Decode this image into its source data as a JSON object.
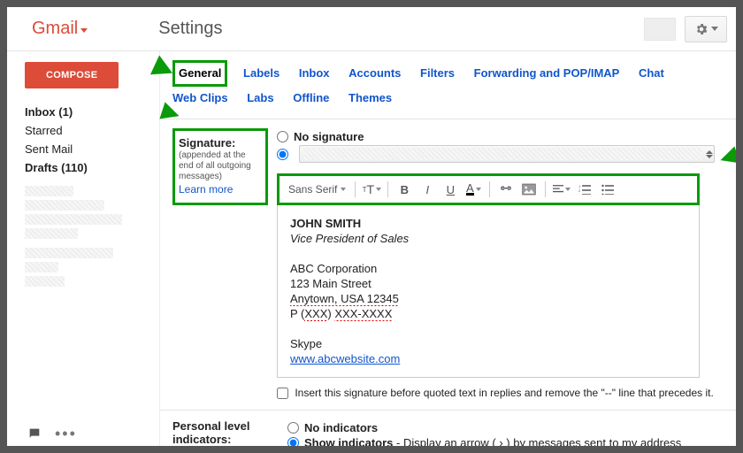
{
  "header": {
    "logo": "Gmail",
    "title": "Settings"
  },
  "sidebar": {
    "compose": "COMPOSE",
    "items": [
      {
        "label": "Inbox (1)",
        "bold": true
      },
      {
        "label": "Starred",
        "bold": false
      },
      {
        "label": "Sent Mail",
        "bold": false
      },
      {
        "label": "Drafts (110)",
        "bold": true
      }
    ]
  },
  "tabs": {
    "row1": [
      "General",
      "Labels",
      "Inbox",
      "Accounts",
      "Filters",
      "Forwarding and POP/IMAP",
      "Chat"
    ],
    "row2": [
      "Web Clips",
      "Labs",
      "Offline",
      "Themes"
    ]
  },
  "signature": {
    "heading": "Signature:",
    "hint": "(appended at the end of all outgoing messages)",
    "learn": "Learn more",
    "no_sig": "No signature",
    "font_label": "Sans Serif",
    "editor": {
      "name": "JOHN SMITH",
      "title": "Vice President of Sales",
      "company": "ABC Corporation",
      "street": "123 Main Street",
      "city": "Anytown, USA 12345",
      "phone_prefix": "P (",
      "phone_x1": "XXX",
      "phone_mid": ") ",
      "phone_x2": "XXX-XXXX",
      "skype": "Skype",
      "url": "www.abcwebsite.com"
    },
    "insert_label": "Insert this signature before quoted text in replies and remove the \"--\" line that precedes it."
  },
  "indicators": {
    "heading": "Personal level indicators:",
    "no_label": "No indicators",
    "show_label": "Show indicators",
    "show_desc": " - Display an arrow ( › ) by messages sent to my address"
  }
}
